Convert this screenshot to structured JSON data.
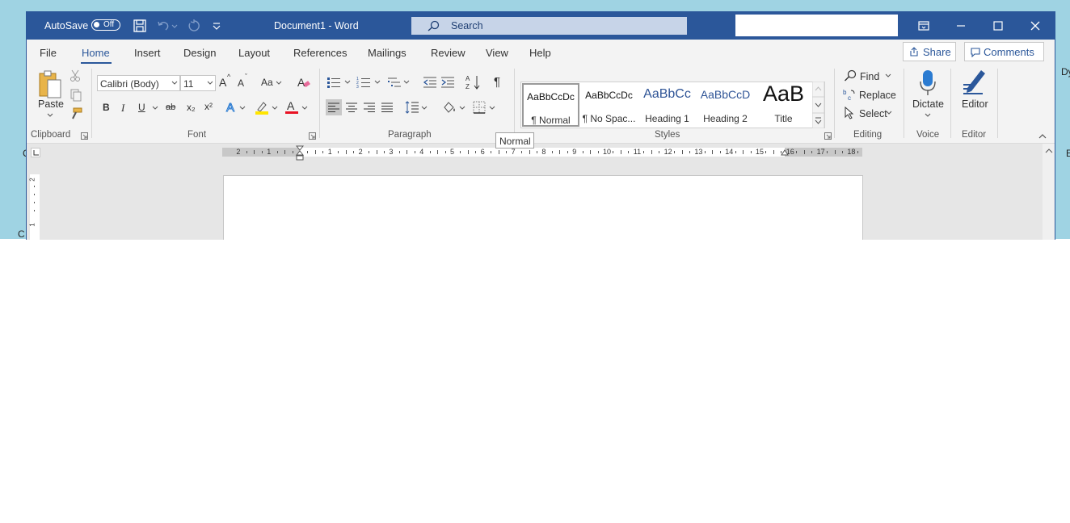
{
  "desktop": {
    "right_letters": [
      "Dy",
      "E"
    ],
    "left_letters": [
      "C",
      "C"
    ]
  },
  "titlebar": {
    "autosave_label": "AutoSave",
    "autosave_state": "Off",
    "doc_title": "Document1  -  Word",
    "search_placeholder": "Search"
  },
  "tabs": [
    "File",
    "Home",
    "Insert",
    "Design",
    "Layout",
    "References",
    "Mailings",
    "Review",
    "View",
    "Help"
  ],
  "active_tab": "Home",
  "share_label": "Share",
  "comments_label": "Comments",
  "clipboard": {
    "paste_label": "Paste",
    "group_label": "Clipboard"
  },
  "font": {
    "font_name": "Calibri (Body)",
    "font_size": "11",
    "change_case_label": "Aa",
    "group_label": "Font",
    "bold": "B",
    "italic": "I",
    "underline": "U",
    "strike": "ab",
    "subscript": "x₂",
    "superscript": "x²",
    "grow": "A",
    "shrink": "A"
  },
  "paragraph": {
    "group_label": "Paragraph"
  },
  "styles": {
    "group_label": "Styles",
    "items": [
      {
        "preview": "AaBbCcDc",
        "name": "¶ Normal"
      },
      {
        "preview": "AaBbCcDc",
        "name": "¶ No Spac..."
      },
      {
        "preview": "AaBbCc",
        "name": "Heading 1"
      },
      {
        "preview": "AaBbCcD",
        "name": "Heading 2"
      },
      {
        "preview": "AaB",
        "name": "Title"
      }
    ]
  },
  "editing": {
    "find_label": "Find",
    "replace_label": "Replace",
    "select_label": "Select",
    "group_label": "Editing"
  },
  "voice": {
    "dictate_label": "Dictate",
    "group_label": "Voice"
  },
  "editor_group": {
    "editor_label": "Editor",
    "group_label": "Editor"
  },
  "ruler": {
    "numbers": [
      "2",
      "1",
      "1",
      "2",
      "3",
      "4",
      "5",
      "6",
      "7",
      "8",
      "9",
      "10",
      "11",
      "12",
      "13",
      "14",
      "15",
      "16",
      "17",
      "18"
    ]
  },
  "tooltip": "Normal",
  "vruler_numbers": [
    "2",
    "1"
  ],
  "colors": {
    "brand": "#2b579a",
    "ribbon_bg": "#f3f3f3",
    "search_bg": "#c7d4e8",
    "desktop": "#9fd3e3"
  }
}
